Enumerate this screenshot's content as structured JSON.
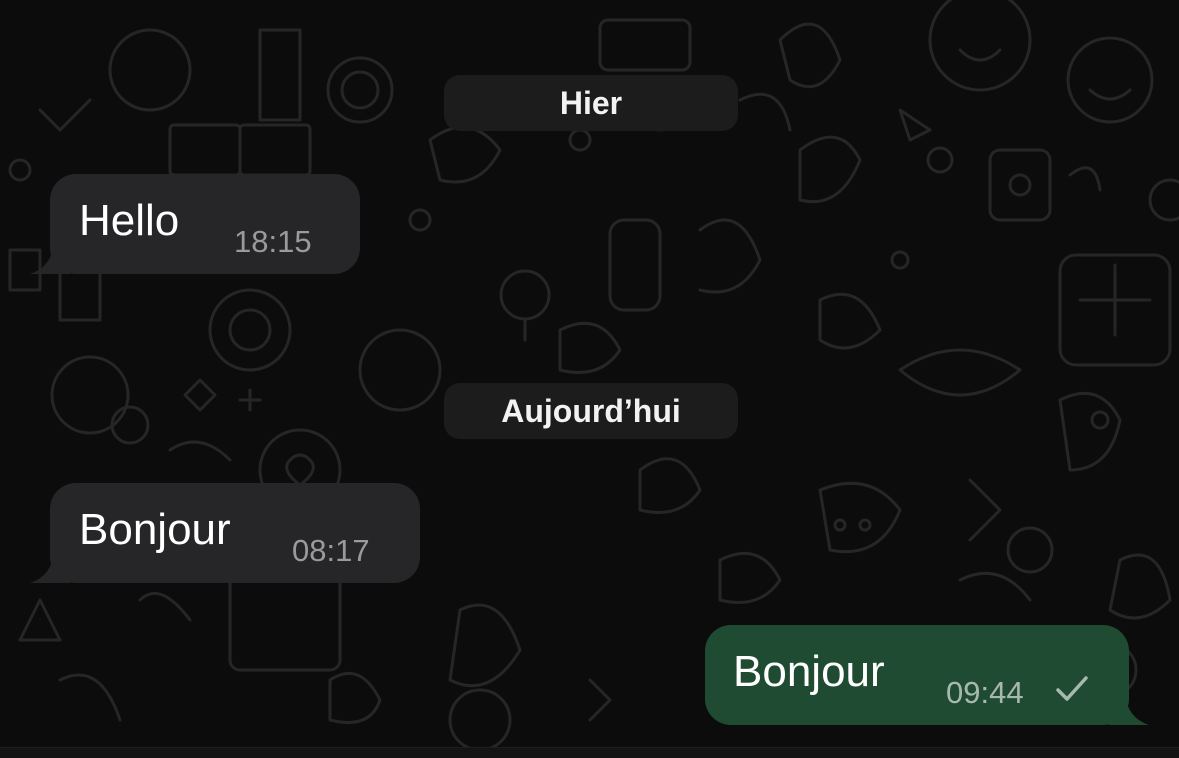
{
  "chat": {
    "date_separators": {
      "yesterday": "Hier",
      "today": "Aujourd’hui"
    },
    "messages": [
      {
        "direction": "incoming",
        "text": "Hello",
        "time": "18:15"
      },
      {
        "direction": "incoming",
        "text": "Bonjour",
        "time": "08:17"
      },
      {
        "direction": "outgoing",
        "text": "Bonjour",
        "time": "09:44",
        "status_icon": "single-check-icon"
      }
    ]
  },
  "colors": {
    "background": "#0c0c0c",
    "incoming_bubble": "#262628",
    "outgoing_bubble": "#1f4b32",
    "date_pill": "#1c1c1d",
    "timestamp": "#9a9a9d"
  }
}
